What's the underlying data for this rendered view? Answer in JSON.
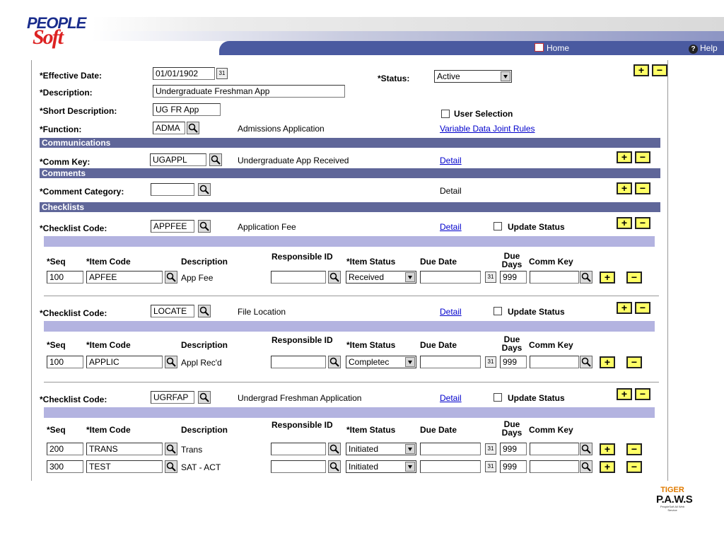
{
  "header": {
    "home_label": "Home",
    "help_label": "Help"
  },
  "form": {
    "effective_date_label": "*Effective Date:",
    "effective_date_value": "01/01/1902",
    "status_label": "*Status:",
    "status_value": "Active",
    "description_label": "*Description:",
    "description_value": "Undergraduate Freshman App",
    "short_description_label": "*Short Description:",
    "short_description_value": "UG FR App",
    "user_selection_label": "User Selection",
    "function_label": "*Function:",
    "function_value": "ADMA",
    "function_desc": "Admissions Application",
    "variable_data_link": "Variable Data Joint Rules"
  },
  "communications": {
    "section_title": "Communications",
    "comm_key_label": "*Comm Key:",
    "comm_key_value": "UGAPPL",
    "comm_key_desc": "Undergraduate App Received",
    "detail_link": "Detail"
  },
  "comments": {
    "section_title": "Comments",
    "category_label": "*Comment Category:",
    "category_value": "",
    "detail_text": "Detail"
  },
  "checklists": {
    "section_title": "Checklists",
    "code_label": "*Checklist Code:",
    "detail_link": "Detail",
    "update_status_label": "Update Status",
    "columns": {
      "seq": "*Seq",
      "item_code": "*Item Code",
      "description": "Description",
      "responsible_id": "Responsible ID",
      "item_status": "*Item Status",
      "due_date": "Due Date",
      "due_days": "Due Days",
      "comm_key": "Comm Key"
    },
    "blocks": [
      {
        "code": "APPFEE",
        "desc": "Application Fee",
        "rows": [
          {
            "seq": "100",
            "item_code": "APFEE",
            "description": "App Fee",
            "responsible_id": "",
            "status": "Received",
            "due_date": "",
            "due_days": "999",
            "comm_key": ""
          }
        ]
      },
      {
        "code": "LOCATE",
        "desc": "File Location",
        "rows": [
          {
            "seq": "100",
            "item_code": "APPLIC",
            "description": "Appl Rec'd",
            "responsible_id": "",
            "status": "Completec",
            "due_date": "",
            "due_days": "999",
            "comm_key": ""
          }
        ]
      },
      {
        "code": "UGRFAP",
        "desc": "Undergrad Freshman Application",
        "rows": [
          {
            "seq": "200",
            "item_code": "TRANS",
            "description": "Trans",
            "responsible_id": "",
            "status": "Initiated",
            "due_date": "",
            "due_days": "999",
            "comm_key": ""
          },
          {
            "seq": "300",
            "item_code": "TEST",
            "description": "SAT - ACT",
            "responsible_id": "",
            "status": "Initiated",
            "due_date": "",
            "due_days": "999",
            "comm_key": ""
          }
        ]
      }
    ]
  },
  "footer_logo": {
    "line1": "TIGER",
    "line2": "P.A.W.S",
    "line3": "PeopleSoft All Web Service"
  },
  "colors": {
    "section_bar": "#5f6699",
    "grid_band": "#b3b3e0",
    "nav": "#4a5aa0",
    "button_fill": "#ffff66"
  }
}
